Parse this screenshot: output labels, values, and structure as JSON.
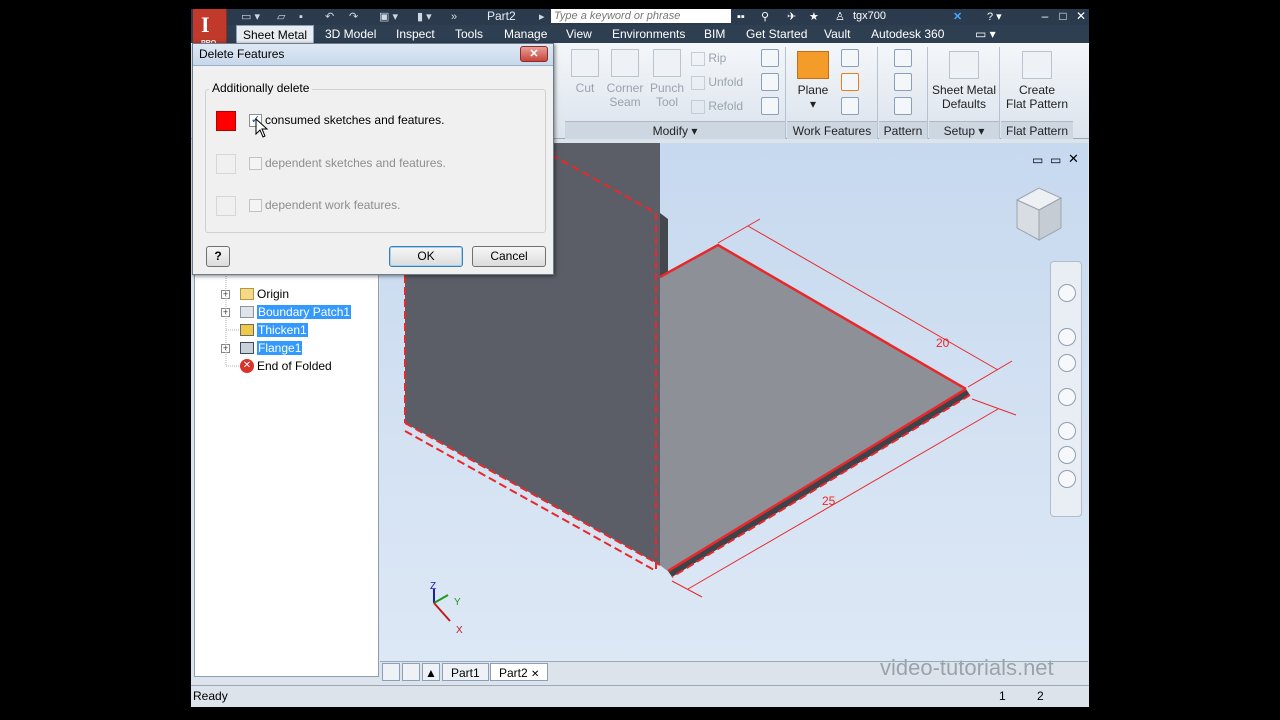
{
  "titlebar": {
    "document": "Part2",
    "search_placeholder": "Type a keyword or phrase",
    "user": "tgx700",
    "logo_text": "I",
    "logo_sub": "PRO"
  },
  "tabs": [
    "Sheet Metal",
    "3D Model",
    "Inspect",
    "Tools",
    "Manage",
    "View",
    "Environments",
    "BIM",
    "Get Started",
    "Vault",
    "Autodesk 360"
  ],
  "ribbon": {
    "modify": {
      "label": "Modify",
      "cut": "Cut",
      "corner_seam": [
        "Corner",
        "Seam"
      ],
      "punch_tool": [
        "Punch",
        "Tool"
      ],
      "rip": "Rip",
      "unfold": "Unfold",
      "refold": "Refold"
    },
    "work_features": {
      "label": "Work Features",
      "plane": "Plane"
    },
    "pattern": {
      "label": "Pattern"
    },
    "setup": {
      "label": "Setup",
      "defaults": [
        "Sheet Metal",
        "Defaults"
      ]
    },
    "flat_pattern": {
      "label": "Flat Pattern",
      "create": [
        "Create",
        "Flat Pattern"
      ]
    }
  },
  "browser": {
    "items": [
      {
        "label": "Origin",
        "selected": false
      },
      {
        "label": "Boundary Patch1",
        "selected": true
      },
      {
        "label": "Thicken1",
        "selected": true
      },
      {
        "label": "Flange1",
        "selected": true
      },
      {
        "label": "End of Folded",
        "selected": false
      }
    ]
  },
  "dialog": {
    "title": "Delete Features",
    "group": "Additionally delete",
    "options": [
      {
        "label": "consumed sketches and features.",
        "checked": true,
        "enabled": true,
        "color": "#ff0000"
      },
      {
        "label": "dependent sketches and features.",
        "checked": false,
        "enabled": false
      },
      {
        "label": "dependent work features.",
        "checked": false,
        "enabled": false
      }
    ],
    "ok": "OK",
    "cancel": "Cancel",
    "help": "?"
  },
  "model": {
    "dim_width": "20",
    "dim_length": "25",
    "accent": "#e8282a"
  },
  "axes": {
    "x": "X",
    "y": "Y",
    "z": "Z"
  },
  "doc_tabs": [
    "Part1",
    "Part2"
  ],
  "status": {
    "text": "Ready",
    "n1": "1",
    "n2": "2"
  },
  "watermark": "video-tutorials.net"
}
